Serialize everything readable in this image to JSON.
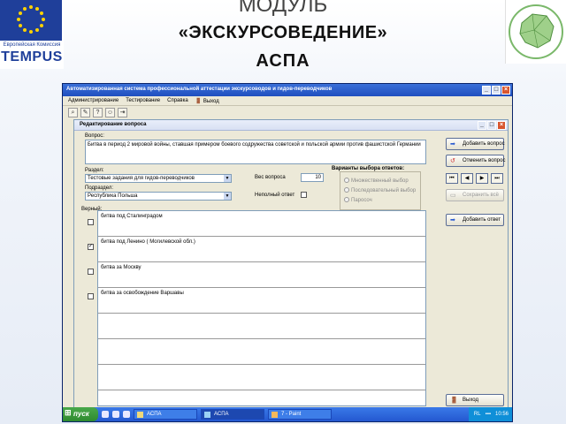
{
  "header": {
    "eu_caption": "Европейская Комиссия",
    "tempus": "TEMPUS",
    "title_line1": "МОДУЛЬ",
    "title_line2": "«ЭКСКУРСОВЕДЕНИЕ»",
    "title_line3": "АСПА"
  },
  "window": {
    "title": "Автоматизированная система профессиональной аттестации экскурсоводов и гидов-переводчиков",
    "menu": [
      "Администрирование",
      "Тестирование",
      "Справка",
      "Выход"
    ]
  },
  "dialog": {
    "title": "Редактирование вопроса",
    "question_label": "Вопрос:",
    "question_text": "Битва в период 2 мировой войны, ставшая примером боевого содружества советской и польской армии против фашистской Германии",
    "section_label": "Раздел:",
    "section_value": "Тестовые задания для гидов-переводчиков",
    "subsection_label": "Подраздел:",
    "subsection_value": "Республика Польша",
    "weight_label": "Вес вопроса",
    "weight_value": "10",
    "incomplete_label": "Неполный ответ",
    "variants_label": "Варианты выбора ответов:",
    "variants": [
      "Множественный выбор",
      "Последовательный выбор",
      "Паросоч"
    ],
    "correct_label": "Верный:",
    "answers": [
      {
        "text": "битва под Сталинградом",
        "checked": false
      },
      {
        "text": "битва под Ленино ( Могилевской обл.)",
        "checked": true
      },
      {
        "text": "битва за Москву",
        "checked": false
      },
      {
        "text": "битва за освобождение Варшавы",
        "checked": false
      },
      {
        "text": "",
        "checked": false
      },
      {
        "text": "",
        "checked": false
      }
    ],
    "buttons": {
      "add_question": "Добавить вопрос",
      "cancel_question": "Отменить вопрос",
      "save_all": "Сохранить всё",
      "add_answer": "Добавить ответ",
      "exit": "Выход"
    }
  },
  "taskbar": {
    "start": "пуск",
    "tasks": [
      "АСПА",
      "АСПА",
      "7 - Paint"
    ],
    "lang": "RL",
    "clock": "10:56"
  }
}
